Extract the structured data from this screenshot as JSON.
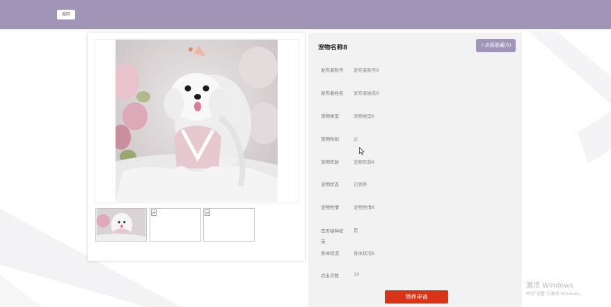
{
  "header": {
    "back_label": "返回"
  },
  "detail": {
    "title": "宠物名称8",
    "collect_label": "☆点我收藏(0)",
    "fields": [
      {
        "label": "发布者账号",
        "value": "发布者账号8"
      },
      {
        "label": "发布者姓名",
        "value": "发布者姓名8"
      },
      {
        "label": "宠物类型",
        "value": "宠物类型8"
      },
      {
        "label": "宠物性别",
        "value": "公"
      },
      {
        "label": "宠物年龄",
        "value": "宠物年龄8"
      },
      {
        "label": "宠物状态",
        "value": "已领养"
      },
      {
        "label": "宠物性情",
        "value": "宠物性情8"
      },
      {
        "label": "是否接种疫苗",
        "value": "是"
      },
      {
        "label": "身体状况",
        "value": "身体状况8"
      },
      {
        "label": "点击次数",
        "value": "10"
      }
    ],
    "apply_label": "领养申请"
  },
  "watermark": {
    "title": "激活 Windows",
    "subtitle": "转到\"设置\"以激活 Windows。"
  },
  "colors": {
    "header_bg": "#a094b7",
    "collect_bg": "#a094b7",
    "apply_bg": "#d93418",
    "panel_bg": "#f2f2f2"
  }
}
